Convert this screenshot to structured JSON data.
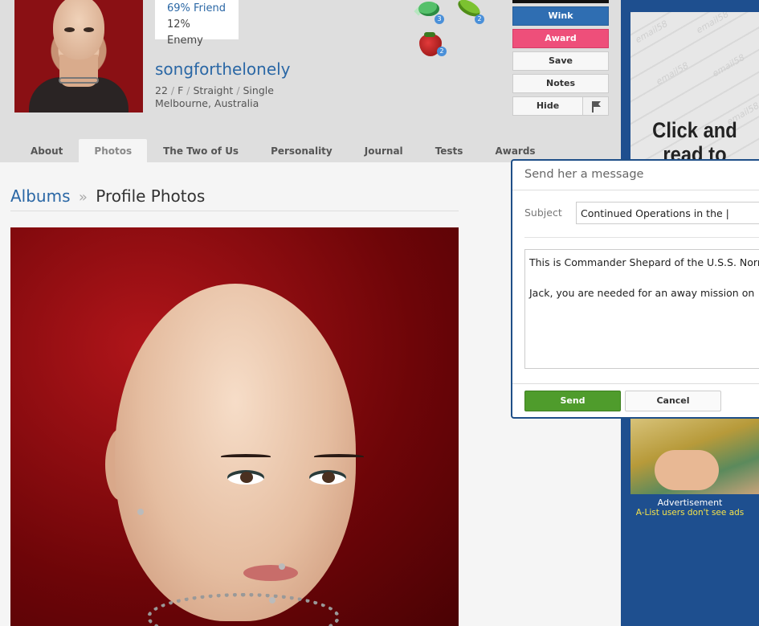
{
  "profile": {
    "username": "songforthelonely",
    "age": "22",
    "gender": "F",
    "orientation": "Straight",
    "status": "Single",
    "location": "Melbourne, Australia",
    "friend_match": "69% Friend",
    "enemy_match": "12% Enemy"
  },
  "gifts": [
    {
      "name": "candy-gift-icon",
      "count": "3"
    },
    {
      "name": "peas-gift-icon",
      "count": "2"
    },
    {
      "name": "strawberry-gift-icon",
      "count": "2"
    }
  ],
  "actions": {
    "wink": "Wink",
    "award": "Award",
    "save": "Save",
    "notes": "Notes",
    "hide": "Hide"
  },
  "tabs": [
    {
      "label": "About"
    },
    {
      "label": "Photos",
      "active": true
    },
    {
      "label": "The Two of Us"
    },
    {
      "label": "Personality"
    },
    {
      "label": "Journal"
    },
    {
      "label": "Tests"
    },
    {
      "label": "Awards"
    }
  ],
  "breadcrumb": {
    "albums": "Albums",
    "separator": "»",
    "current": "Profile Photos"
  },
  "message": {
    "title": "Send her a message",
    "subject_label": "Subject",
    "subject_value": "Continued Operations in the |",
    "body": "This is Commander Shepard of the U.S.S. Norr\n\nJack, you are needed for an away mission on",
    "send_label": "Send",
    "cancel_label": "Cancel"
  },
  "ad": {
    "headline": "Click and read to",
    "watermark": "email58",
    "label": "Advertisement",
    "sub": "A-List users don't see ads"
  },
  "colors": {
    "link_blue": "#2a67a5",
    "wink_blue": "#2f6eb2",
    "award_pink": "#ee4f7a",
    "send_green": "#4f9c2c",
    "ad_bg": "#1e4f8f",
    "ad_sub_yellow": "#f6e34a"
  }
}
